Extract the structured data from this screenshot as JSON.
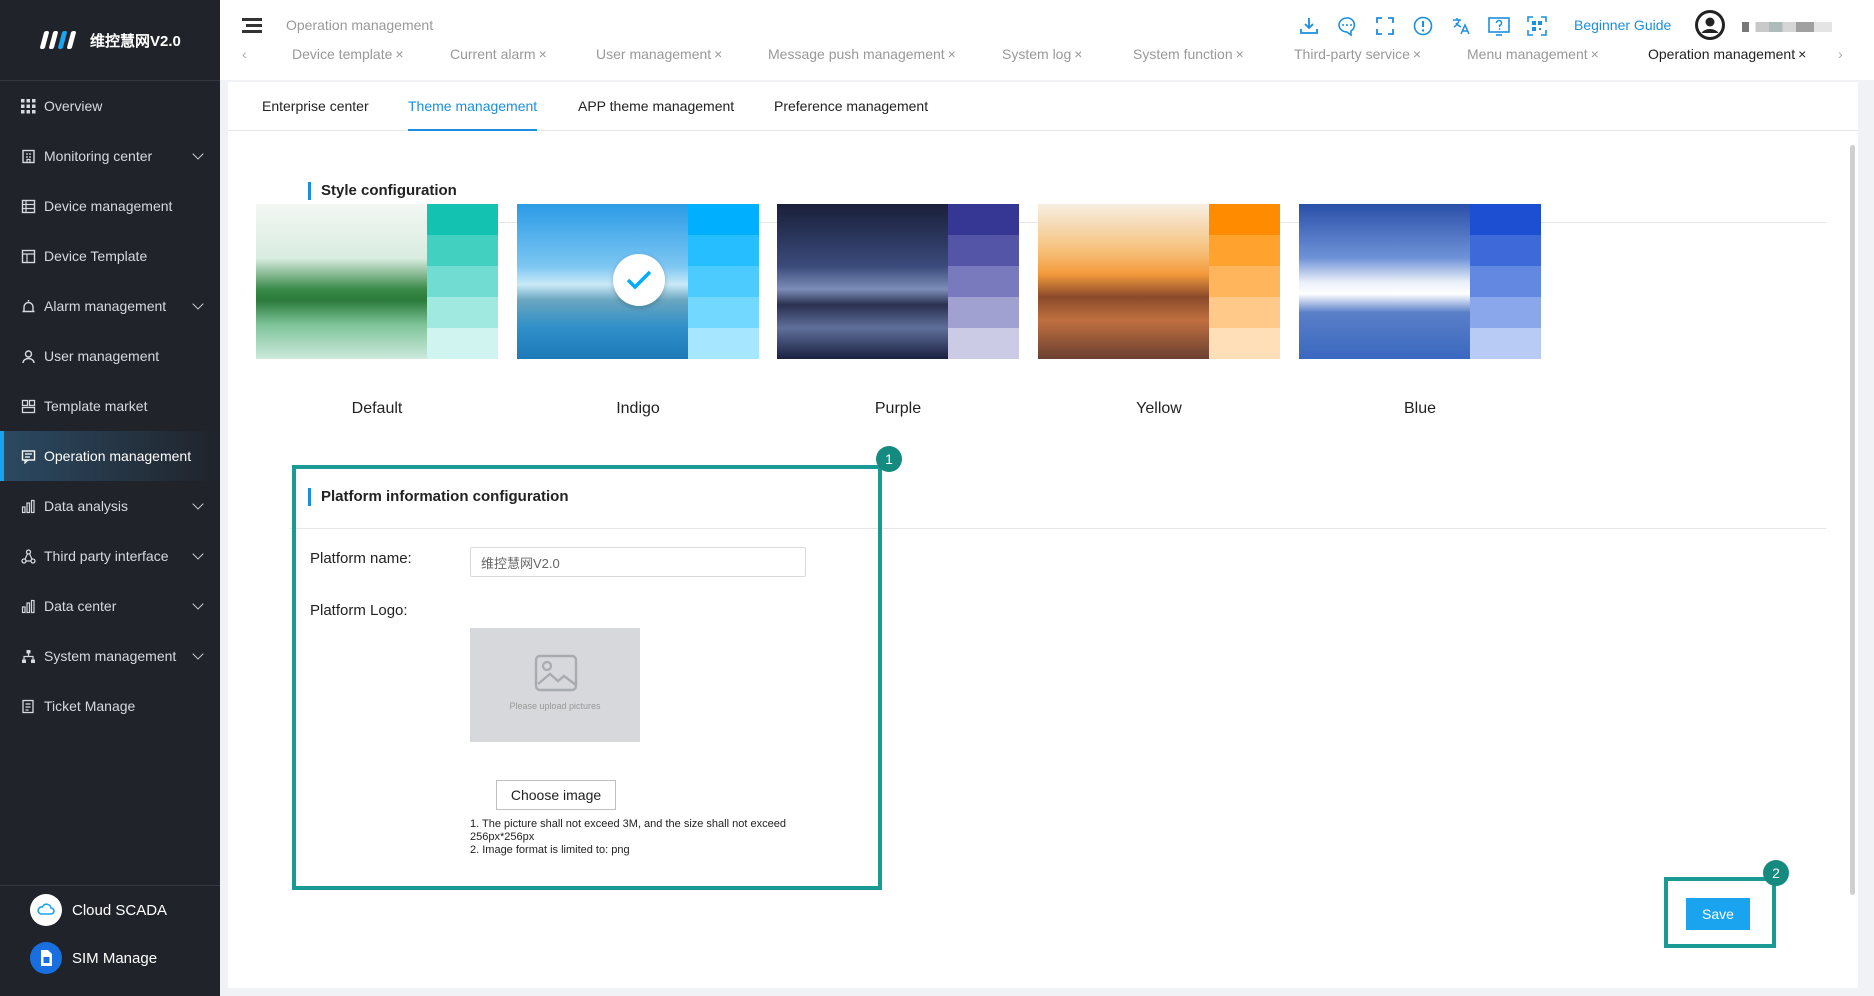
{
  "app": {
    "brand_name": "维控慧网V2.0"
  },
  "sidebar": {
    "items": [
      {
        "label": "Overview",
        "icon": "grid-icon",
        "has_children": false
      },
      {
        "label": "Monitoring center",
        "icon": "building-icon",
        "has_children": true
      },
      {
        "label": "Device management",
        "icon": "device-list-icon",
        "has_children": false
      },
      {
        "label": "Device Template",
        "icon": "template-icon",
        "has_children": false
      },
      {
        "label": "Alarm management",
        "icon": "alarm-icon",
        "has_children": true
      },
      {
        "label": "User management",
        "icon": "user-icon",
        "has_children": false
      },
      {
        "label": "Template market",
        "icon": "market-icon",
        "has_children": false
      },
      {
        "label": "Operation management",
        "icon": "chat-icon",
        "has_children": false,
        "active": true
      },
      {
        "label": "Data analysis",
        "icon": "bar-chart-icon",
        "has_children": true
      },
      {
        "label": "Third party interface",
        "icon": "network-icon",
        "has_children": true
      },
      {
        "label": "Data center",
        "icon": "bar-chart-icon",
        "has_children": true
      },
      {
        "label": "System management",
        "icon": "org-icon",
        "has_children": true
      },
      {
        "label": "Ticket Manage",
        "icon": "ticket-icon",
        "has_children": false
      }
    ],
    "bottom": [
      {
        "label": "Cloud SCADA",
        "icon": "cloud-icon"
      },
      {
        "label": "SIM Manage",
        "icon": "sim-icon"
      }
    ]
  },
  "header": {
    "breadcrumb": "Operation management",
    "beginner_guide": "Beginner Guide",
    "icons": [
      "download-icon",
      "message-icon",
      "fullscreen-icon",
      "alert-icon",
      "translate-icon",
      "help-icon",
      "qr-scan-icon"
    ],
    "tabs": [
      {
        "label": "Device template",
        "active": false
      },
      {
        "label": "Current alarm",
        "active": false
      },
      {
        "label": "User management",
        "active": false
      },
      {
        "label": "Message push management",
        "active": false
      },
      {
        "label": "System log",
        "active": false
      },
      {
        "label": "System function",
        "active": false
      },
      {
        "label": "Third-party service",
        "active": false
      },
      {
        "label": "Menu management",
        "active": false
      },
      {
        "label": "Operation management",
        "active": true
      }
    ],
    "close_glyph": "×",
    "arrow_left": "‹",
    "arrow_right": "›"
  },
  "subtabs": [
    {
      "label": "Enterprise center",
      "active": false
    },
    {
      "label": "Theme management",
      "active": true
    },
    {
      "label": "APP theme management",
      "active": false
    },
    {
      "label": "Preference management",
      "active": false
    }
  ],
  "style_config": {
    "title": "Style configuration",
    "themes": [
      {
        "label": "Default",
        "selected": false,
        "colors": [
          "#13c2b0",
          "#42d0c1",
          "#71ddd2",
          "#a0e9e1",
          "#d0f5f0"
        ]
      },
      {
        "label": "Indigo",
        "selected": true,
        "colors": [
          "#00b0ff",
          "#26beff",
          "#4ccbff",
          "#73d8ff",
          "#a6e6ff"
        ]
      },
      {
        "label": "Purple",
        "selected": false,
        "colors": [
          "#363694",
          "#5555a8",
          "#7979bd",
          "#a0a0d1",
          "#cbcbe6"
        ]
      },
      {
        "label": "Yellow",
        "selected": false,
        "colors": [
          "#ff8c00",
          "#ffa22e",
          "#ffb55c",
          "#ffc98a",
          "#ffdfb8"
        ]
      },
      {
        "label": "Blue",
        "selected": false,
        "colors": [
          "#1c4fd1",
          "#3e6ad9",
          "#6388e2",
          "#8aa7eb",
          "#b8cbf4"
        ]
      }
    ]
  },
  "platform_config": {
    "title": "Platform information configuration",
    "name_label": "Platform name:",
    "name_value": "维控慧网V2.0",
    "logo_label": "Platform Logo:",
    "upload_placeholder": "Please upload pictures",
    "choose_image": "Choose image",
    "hint_1": "1. The picture shall not exceed 3M, and the size shall not exceed 256px*256px",
    "hint_2": "2. Image format is limited to: png"
  },
  "annotations": {
    "badge_1": "1",
    "badge_2": "2",
    "highlight_color": "#1a9a94"
  },
  "actions": {
    "save": "Save"
  }
}
